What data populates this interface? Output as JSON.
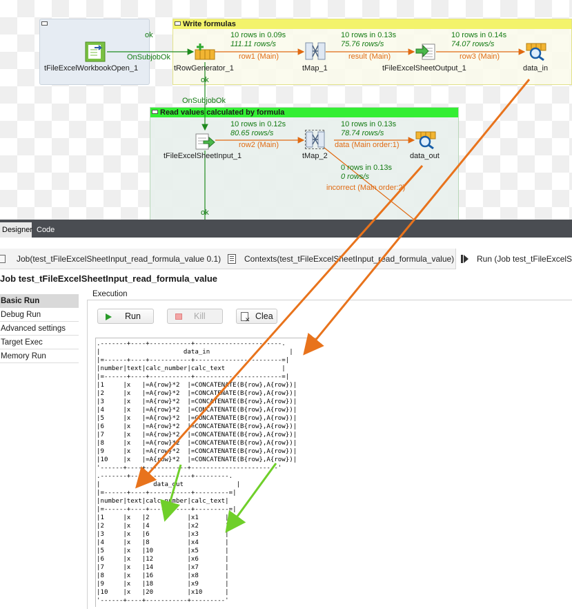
{
  "canvas": {
    "subjob1": {
      "title": "Write formulas",
      "color": "#f3f36b"
    },
    "subjob2": {
      "title": "Read values calculated by formula",
      "color": "#33ee33"
    },
    "components": [
      {
        "id": "wbopen",
        "label": "tFileExcelWorkbookOpen_1",
        "icon": "excel-workbook-icon"
      },
      {
        "id": "rowgen",
        "label": "tRowGenerator_1",
        "icon": "row-generator-icon"
      },
      {
        "id": "tmap1",
        "label": "tMap_1",
        "icon": "tmap-icon"
      },
      {
        "id": "sheetout",
        "label": "tFileExcelSheetOutput_1",
        "icon": "excel-output-icon"
      },
      {
        "id": "datain",
        "label": "data_in",
        "icon": "log-row-icon"
      },
      {
        "id": "sheetin",
        "label": "tFileExcelSheetInput_1",
        "icon": "excel-input-icon"
      },
      {
        "id": "tmap2",
        "label": "tMap_2",
        "icon": "tmap-icon"
      },
      {
        "id": "dataout",
        "label": "data_out",
        "icon": "log-row-icon"
      }
    ],
    "links": {
      "ok1": "ok",
      "onsubjob1": "OnSubjobOk",
      "ok2": "ok",
      "onsubjob2": "OnSubjobOk",
      "ok3": "ok",
      "row1": {
        "stat1": "10 rows in 0.09s",
        "stat2": "111.11 rows/s",
        "name": "row1 (Main)"
      },
      "result": {
        "stat1": "10 rows in 0.13s",
        "stat2": "75.76 rows/s",
        "name": "result (Main)"
      },
      "row3": {
        "stat1": "10 rows in 0.14s",
        "stat2": "74.07 rows/s",
        "name": "row3 (Main)"
      },
      "row2": {
        "stat1": "10 rows in 0.12s",
        "stat2": "80.65 rows/s",
        "name": "row2 (Main)"
      },
      "data": {
        "stat1": "10 rows in 0.13s",
        "stat2": "78.74 rows/s",
        "name": "data (Main order:1)"
      },
      "incorrect": {
        "stat1": "0 rows in 0.13s",
        "stat2": "0 rows/s",
        "name": "incorrect (Main order:2)"
      }
    }
  },
  "designer_tabs": [
    "Designer",
    "Code"
  ],
  "view_tabs": [
    {
      "label": "Job(test_tFileExcelSheetInput_read_formula_value 0.1)",
      "icon": "job-icon"
    },
    {
      "label": "Contexts(test_tFileExcelSheetInput_read_formula_value)",
      "icon": "contexts-icon"
    },
    {
      "label": "Run (Job test_tFileExcelSh",
      "icon": "run-view-icon"
    }
  ],
  "job_title": "Job test_tFileExcelSheetInput_read_formula_value",
  "left_nav": [
    "Basic Run",
    "Debug Run",
    "Advanced settings",
    "Target Exec",
    "Memory Run"
  ],
  "execution_label": "Execution",
  "buttons": {
    "run": "Run",
    "kill": "Kill",
    "clear": "Clea"
  },
  "console": {
    "data_in": ".-------+----+-----------+-----------------------.\n|                      data_in                     |\n|=------+----+-----------+-----------------------=|\n|number|text|calc_number|calc_text               |\n|=------+----+-----------+-----------------------=|\n|1     |x   |=A{row}*2  |=CONCATENATE(B{row},A{row})|\n|2     |x   |=A{row}*2  |=CONCATENATE(B{row},A{row})|\n|3     |x   |=A{row}*2  |=CONCATENATE(B{row},A{row})|\n|4     |x   |=A{row}*2  |=CONCATENATE(B{row},A{row})|\n|5     |x   |=A{row}*2  |=CONCATENATE(B{row},A{row})|\n|6     |x   |=A{row}*2  |=CONCATENATE(B{row},A{row})|\n|7     |x   |=A{row}*2  |=CONCATENATE(B{row},A{row})|\n|8     |x   |=A{row}*2  |=CONCATENATE(B{row},A{row})|\n|9     |x   |=A{row}*2  |=CONCATENATE(B{row},A{row})|\n|10    |x   |=A{row}*2  |=CONCATENATE(B{row},A{row})|\n'------+----+-----------+-----------------------'",
    "data_out": ".-------+----+-----------+---------.\n|              data_out              |\n|=------+----+-----------+---------=|\n|number|text|calc_number|calc_text|\n|=------+----+-----------+---------=|\n|1     |x   |2          |x1       |\n|2     |x   |4          |x2       |\n|3     |x   |6          |x3       |\n|4     |x   |8          |x4       |\n|5     |x   |10         |x5       |\n|6     |x   |12         |x6       |\n|7     |x   |14         |x7       |\n|8     |x   |16         |x8       |\n|9     |x   |18         |x9       |\n|10    |x   |20         |x10      |\n'------+----+-----------+---------'"
  },
  "colors": {
    "annotation_orange": "#e8731c",
    "annotation_green": "#6fcf2a",
    "flow_orange": "#e06a12",
    "stat_green": "#127a12"
  }
}
